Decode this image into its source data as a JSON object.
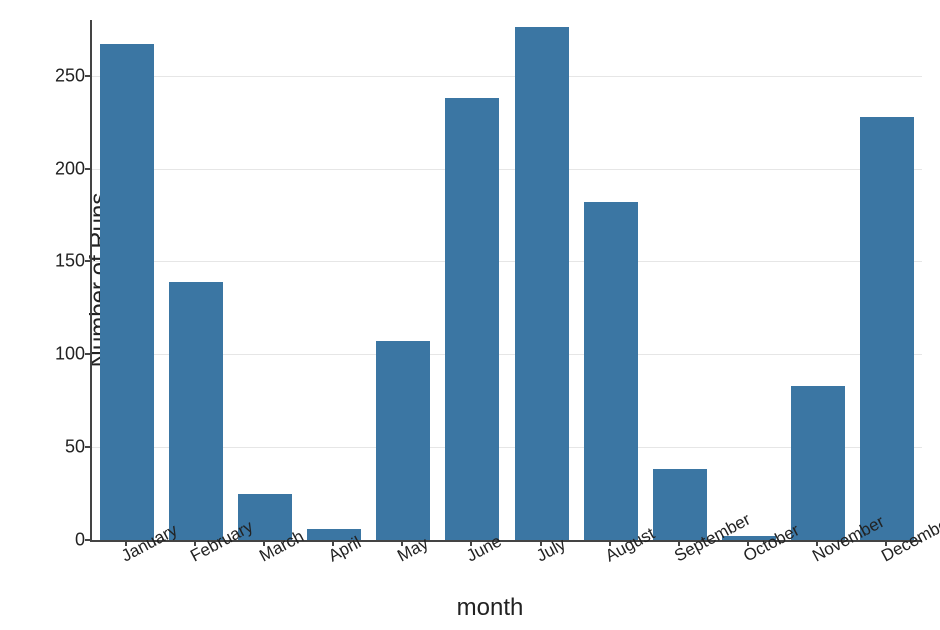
{
  "chart_data": {
    "type": "bar",
    "categories": [
      "January",
      "February",
      "March",
      "April",
      "May",
      "June",
      "July",
      "August",
      "September",
      "October",
      "November",
      "December"
    ],
    "values": [
      267,
      139,
      25,
      6,
      107,
      238,
      276,
      182,
      38,
      2,
      83,
      228
    ],
    "title": "",
    "xlabel": "month",
    "ylabel": "Number of Runs",
    "ylim": [
      0,
      280
    ],
    "y_ticks": [
      0,
      50,
      100,
      150,
      200,
      250
    ],
    "bar_color": "#3b76a3"
  }
}
